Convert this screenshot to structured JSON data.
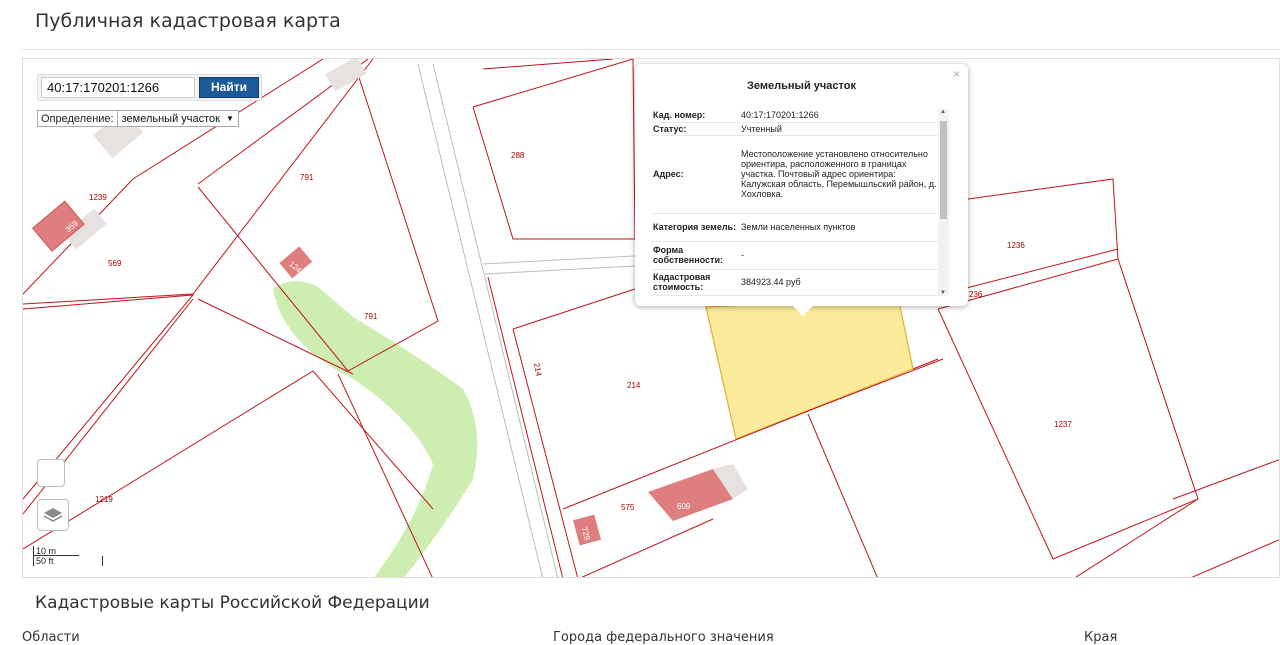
{
  "page": {
    "title": "Публичная кадастровая карта",
    "section_title": "Кадастровые карты Российской Федерации",
    "columns": [
      "Области",
      "Города федерального значения",
      "Края"
    ]
  },
  "search": {
    "value": "40:17:170201:1266",
    "button_label": "Найти",
    "definition_label": "Определение:",
    "definition_value": "земельный участок"
  },
  "map": {
    "parcel_labels": [
      "1239",
      "569",
      "791",
      "791",
      "288",
      "214",
      "214",
      "1236",
      "236",
      "1237",
      "575",
      "1219"
    ],
    "building_labels": [
      "359",
      "1247",
      "609",
      "729"
    ],
    "scale_metric": "10 m",
    "scale_imperial": "50 ft",
    "colors": {
      "boundary": "#c0141c",
      "selected": "#fbeb9a",
      "green": "#cdeeb0",
      "building": "#df7e7e"
    }
  },
  "popup": {
    "title": "Земельный участок",
    "close_icon": "×",
    "rows": [
      {
        "key": "Кад. номер:",
        "value": "40:17:170201:1266"
      },
      {
        "key": "Статус:",
        "value": "Учтенный"
      },
      {
        "key": "Адрес:",
        "value": "Местоположение установлено относительно ориентира, расположенного в границах участка. Почтовый адрес ориентира: Калужская область, Перемышльский район, д. Хохловка."
      },
      {
        "key": "Категория земель:",
        "value": "Земли населенных пунктов"
      },
      {
        "key": "Форма собственности:",
        "value": "-"
      },
      {
        "key": "Кадастровая стоимость:",
        "value": "384923.44 руб"
      }
    ]
  }
}
